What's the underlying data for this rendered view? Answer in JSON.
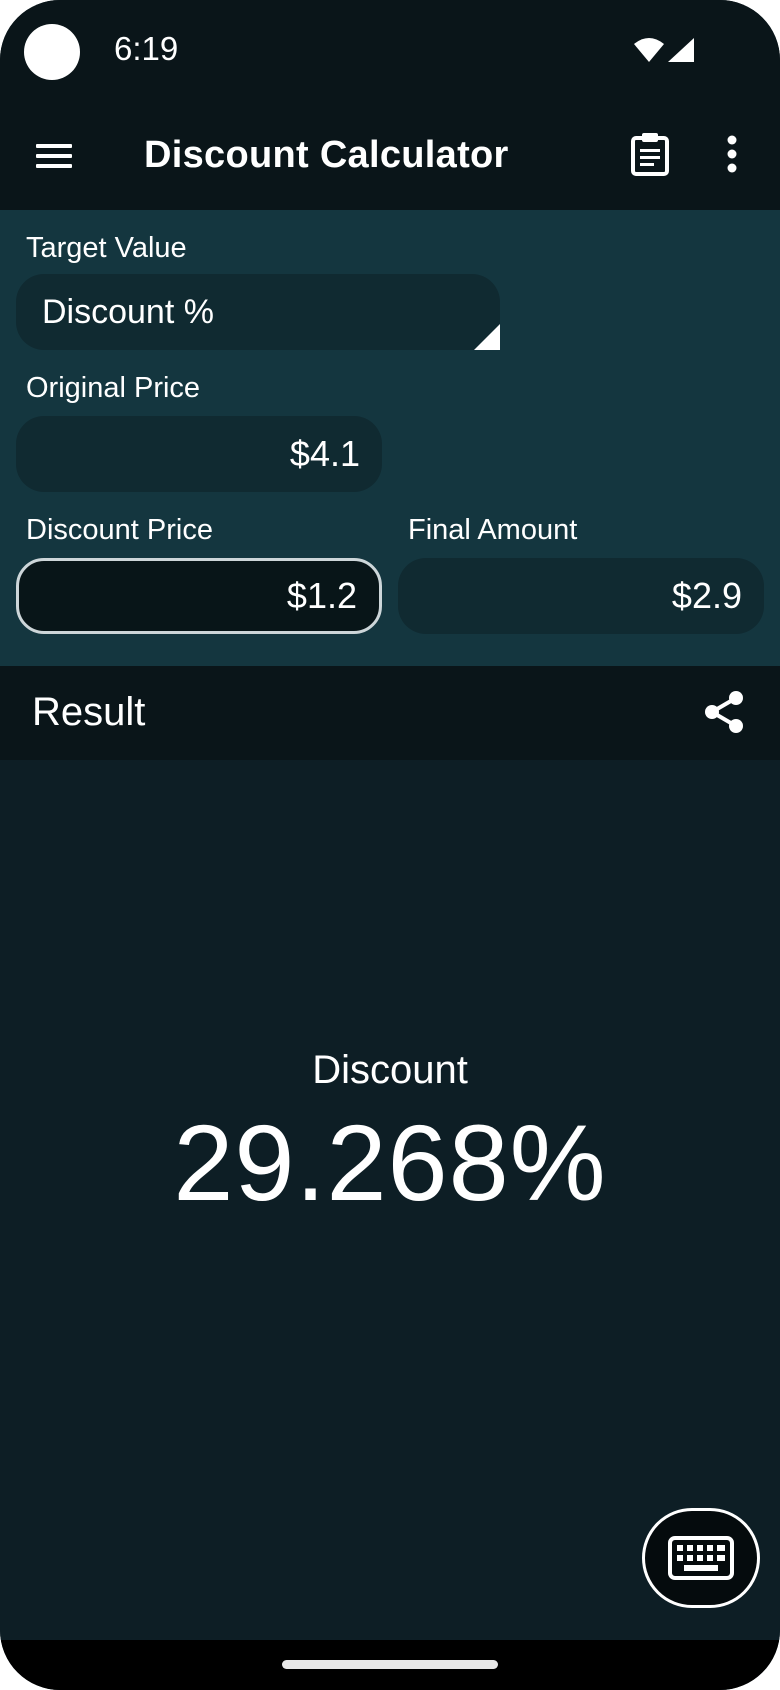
{
  "status_bar": {
    "time": "6:19"
  },
  "app_bar": {
    "title": "Discount Calculator"
  },
  "inputs": {
    "target_value": {
      "label": "Target Value",
      "value": "Discount %"
    },
    "original_price": {
      "label": "Original Price",
      "value": "$4.1"
    },
    "discount_price": {
      "label": "Discount Price",
      "value": "$1.2"
    },
    "final_amount": {
      "label": "Final Amount",
      "value": "$2.9"
    }
  },
  "result": {
    "header": "Result",
    "label": "Discount",
    "value": "29.268%"
  },
  "icons": {
    "menu": "hamburger-menu-icon",
    "clipboard": "clipboard-icon",
    "more": "more-vert-icon",
    "share": "share-icon",
    "keyboard": "keyboard-icon",
    "wifi": "wifi-icon",
    "signal": "signal-icon"
  },
  "colors": {
    "panel": "#14363f",
    "result_bg": "#0d1e25",
    "bar": "#0a1519"
  }
}
